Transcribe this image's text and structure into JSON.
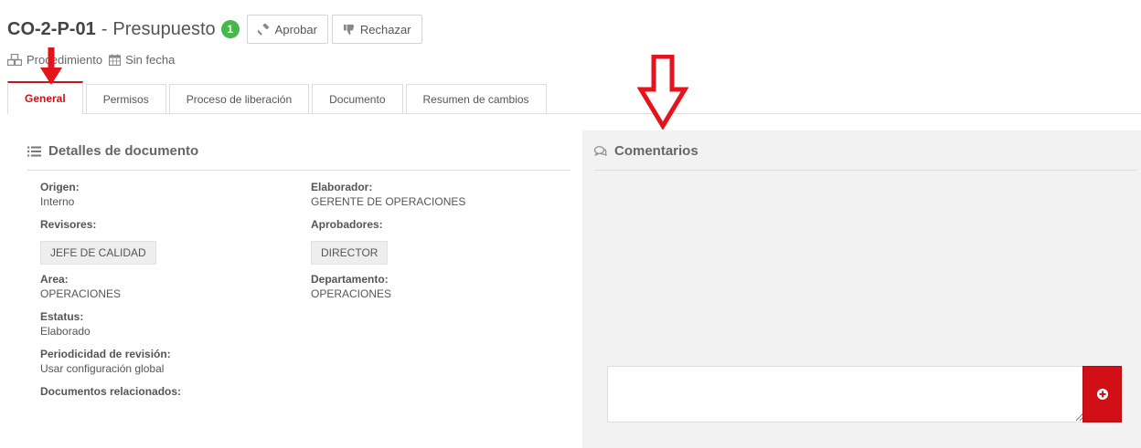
{
  "header": {
    "code": "CO-2-P-01",
    "separator": "-",
    "name": "Presupuesto",
    "version": "1",
    "approve_label": "Aprobar",
    "reject_label": "Rechazar"
  },
  "meta": {
    "type_label": "Procedimiento",
    "date_label": "Sin fecha"
  },
  "tabs": [
    {
      "label": "General",
      "active": true
    },
    {
      "label": "Permisos"
    },
    {
      "label": "Proceso de liberación"
    },
    {
      "label": "Documento"
    },
    {
      "label": "Resumen de cambios"
    }
  ],
  "details": {
    "title": "Detalles de documento",
    "origin_label": "Origen:",
    "origin_value": "Interno",
    "author_label": "Elaborador:",
    "author_value": "GERENTE DE OPERACIONES",
    "reviewers_label": "Revisores:",
    "reviewer_tag": "JEFE DE CALIDAD",
    "approvers_label": "Aprobadores:",
    "approver_tag": "DIRECTOR",
    "area_label": "Area:",
    "area_value": "OPERACIONES",
    "department_label": "Departamento:",
    "department_value": "OPERACIONES",
    "status_label": "Estatus:",
    "status_value": "Elaborado",
    "review_period_label": "Periodicidad de revisión:",
    "review_period_value": "Usar configuración global",
    "related_label": "Documentos relacionados:"
  },
  "comments": {
    "title": "Comentarios",
    "input_value": "",
    "input_placeholder": ""
  },
  "colors": {
    "accent": "#c4161c",
    "badge": "#44b848",
    "annotation_arrow": "#e3141c",
    "panel_bg": "#f2f2f2"
  }
}
